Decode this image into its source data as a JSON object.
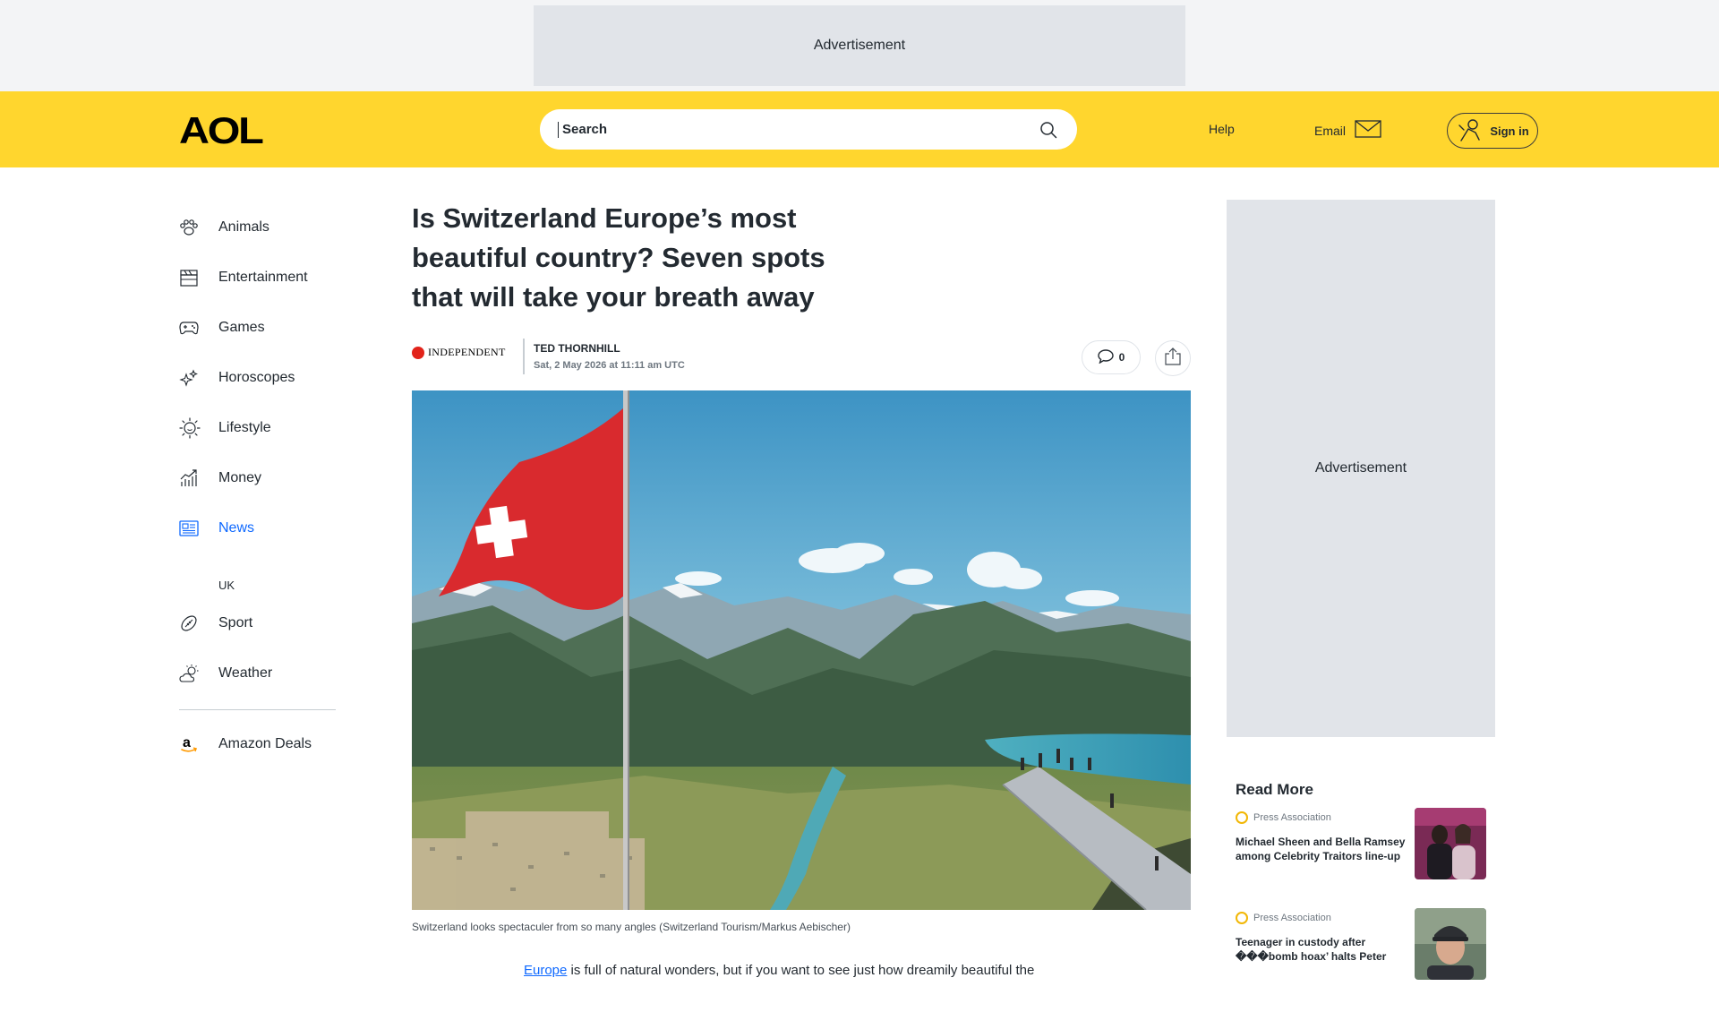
{
  "top_ad": {
    "label": "Advertisement"
  },
  "header": {
    "logo": "AOL",
    "search_label": "Search",
    "help": "Help",
    "email": "Email",
    "signin": "Sign in"
  },
  "nav": {
    "items": [
      {
        "label": "Animals",
        "icon": "paw-icon"
      },
      {
        "label": "Entertainment",
        "icon": "clapperboard-icon"
      },
      {
        "label": "Games",
        "icon": "gamepad-icon"
      },
      {
        "label": "Horoscopes",
        "icon": "sparkles-icon"
      },
      {
        "label": "Lifestyle",
        "icon": "sun-face-icon"
      },
      {
        "label": "Money",
        "icon": "chart-icon"
      },
      {
        "label": "News",
        "icon": "newspaper-icon",
        "active": true
      }
    ],
    "sub_item": "UK",
    "items2": [
      {
        "label": "Sport",
        "icon": "football-icon"
      },
      {
        "label": "Weather",
        "icon": "sun-cloud-icon"
      }
    ],
    "extra": {
      "label": "Amazon Deals",
      "icon": "amazon-icon"
    }
  },
  "article": {
    "title": "Is Switzerland Europe’s most beautiful country? Seven spots that will take your breath away",
    "publisher": "INDEPENDENT",
    "author": "TED THORNHILL",
    "date": "Sat, 2 May 2026 at 11:11 am UTC",
    "comments": "0",
    "caption": "Switzerland looks spectaculer from so many angles (Switzerland Tourism/Markus Aebischer)",
    "body_link": "Europe",
    "body_rest": " is full of natural wonders, but if you want to see just how dreamily beautiful the"
  },
  "rail": {
    "ad_label": "Advertisement",
    "read_more_title": "Read More",
    "items": [
      {
        "source": "Press Association",
        "headline": "Michael Sheen and Bella Ramsey among Celebrity Traitors line-up"
      },
      {
        "source": "Press Association",
        "headline": "Teenager in custody after ���bomb hoax’ halts Peter"
      }
    ]
  },
  "colors": {
    "brand_yellow": "#ffd62e",
    "link_blue": "#0f69ff",
    "ad_gray": "#e1e4e9"
  }
}
